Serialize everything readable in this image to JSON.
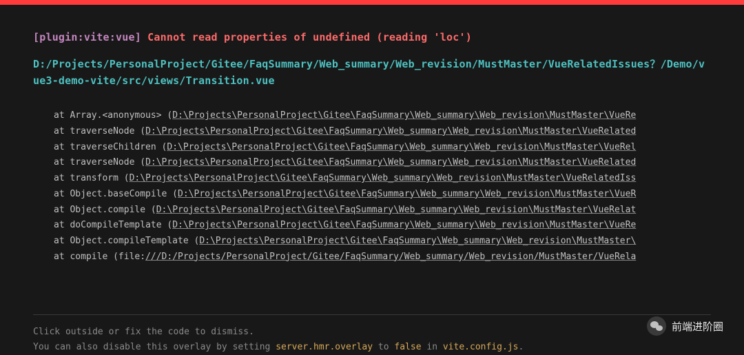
{
  "header": {
    "plugin_tag": "[plugin:vite:vue]",
    "error_message": "Cannot read properties of undefined (reading 'loc')"
  },
  "file_path": "D:/Projects/PersonalProject/Gitee/FaqSummary/Web_summary/Web_revision/MustMaster/VueRelatedIssues？/Demo/vue3-demo-vite/src/views/Transition.vue",
  "stack": [
    {
      "at": "at Array.<anonymous> (",
      "path": "D:\\Projects\\PersonalProject\\Gitee\\FaqSummary\\Web_summary\\Web_revision\\MustMaster\\VueRe"
    },
    {
      "at": "at traverseNode (",
      "path": "D:\\Projects\\PersonalProject\\Gitee\\FaqSummary\\Web_summary\\Web_revision\\MustMaster\\VueRelated"
    },
    {
      "at": "at traverseChildren (",
      "path": "D:\\Projects\\PersonalProject\\Gitee\\FaqSummary\\Web_summary\\Web_revision\\MustMaster\\VueRel"
    },
    {
      "at": "at traverseNode (",
      "path": "D:\\Projects\\PersonalProject\\Gitee\\FaqSummary\\Web_summary\\Web_revision\\MustMaster\\VueRelated"
    },
    {
      "at": "at transform (",
      "path": "D:\\Projects\\PersonalProject\\Gitee\\FaqSummary\\Web_summary\\Web_revision\\MustMaster\\VueRelatedIss"
    },
    {
      "at": "at Object.baseCompile (",
      "path": "D:\\Projects\\PersonalProject\\Gitee\\FaqSummary\\Web_summary\\Web_revision\\MustMaster\\VueR"
    },
    {
      "at": "at Object.compile (",
      "path": "D:\\Projects\\PersonalProject\\Gitee\\FaqSummary\\Web_summary\\Web_revision\\MustMaster\\VueRelat"
    },
    {
      "at": "at doCompileTemplate (",
      "path": "D:\\Projects\\PersonalProject\\Gitee\\FaqSummary\\Web_summary\\Web_revision\\MustMaster\\VueRe"
    },
    {
      "at": "at Object.compileTemplate (",
      "path": "D:\\Projects\\PersonalProject\\Gitee\\FaqSummary\\Web_summary\\Web_revision\\MustMaster\\"
    },
    {
      "at": "at compile (file:",
      "path": "///D:/Projects/PersonalProject/Gitee/FaqSummary/Web_summary/Web_revision/MustMaster/VueRela"
    }
  ],
  "tip": {
    "line1": "Click outside or fix the code to dismiss.",
    "line2_pre": "You can also disable this overlay by setting ",
    "line2_code1": "server.hmr.overlay",
    "line2_mid": " to ",
    "line2_code2": "false",
    "line2_mid2": " in ",
    "line2_code3": "vite.config.js",
    "line2_end": "."
  },
  "watermark": {
    "text": "前端进阶圈"
  }
}
